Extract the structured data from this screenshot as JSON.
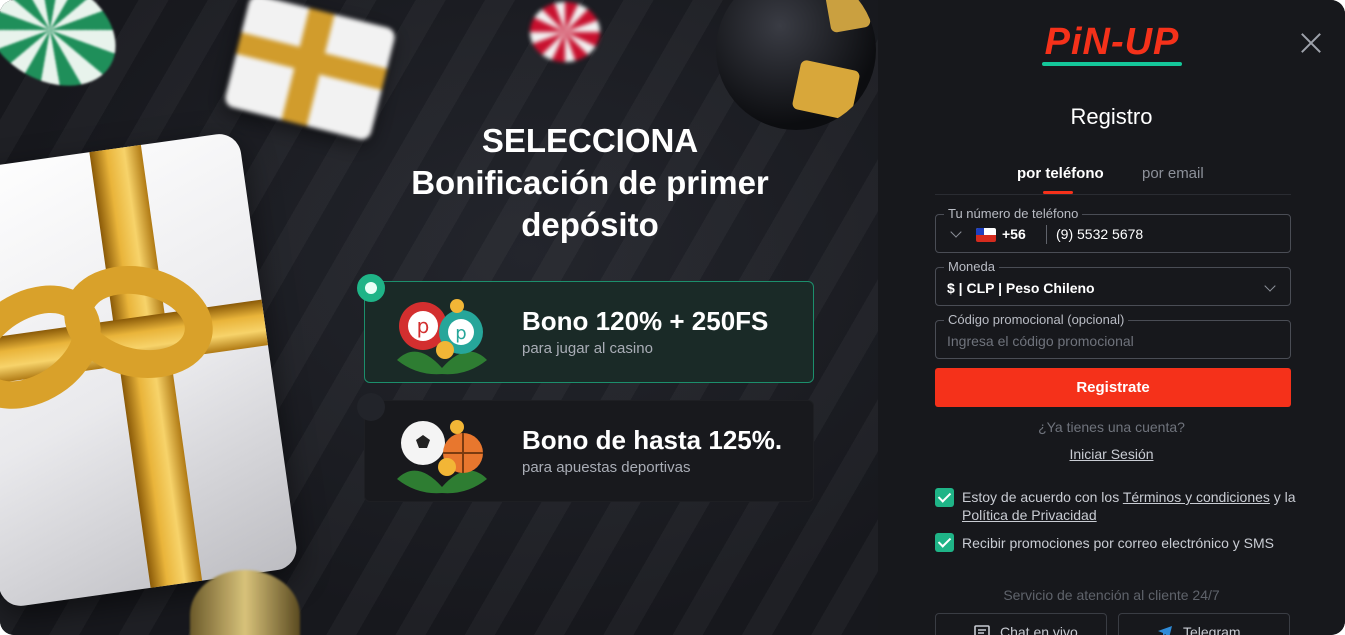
{
  "promo": {
    "headline_1": "SELECCIONA",
    "headline_2": "Bonificación de primer",
    "headline_3": "depósito",
    "bonuses": [
      {
        "title": "Bono 120% + 250FS",
        "subtitle": "para jugar al casino",
        "selected": true
      },
      {
        "title": "Bono de hasta 125%.",
        "subtitle": "para apuestas deportivas",
        "selected": false
      }
    ]
  },
  "panel": {
    "logo": "PiN-UP",
    "title": "Registro",
    "tabs": [
      {
        "label": "por teléfono",
        "active": true
      },
      {
        "label": "por email",
        "active": false
      }
    ],
    "phone": {
      "label": "Tu número de teléfono",
      "country_code": "+56",
      "value": "(9) 5532 5678"
    },
    "currency": {
      "label": "Moneda",
      "value": "$ | CLP | Peso Chileno"
    },
    "promo_code": {
      "label": "Código promocional (opcional)",
      "placeholder": "Ingresa el código promocional"
    },
    "register_button": "Registrate",
    "have_account": "¿Ya tienes una cuenta?",
    "login_link": "Iniciar Sesión",
    "terms": {
      "prefix": "Estoy de acuerdo con los ",
      "terms_link": "Términos y condiciones",
      "middle": " y la ",
      "privacy_link": "Política de Privacidad",
      "checked": true
    },
    "promos_consent": {
      "label": "Recibir promociones por correo electrónico y SMS",
      "checked": true
    },
    "support_text": "Servicio de atención al cliente 24/7",
    "chat_button": "Chat en vivo",
    "telegram_button": "Telegram"
  },
  "colors": {
    "accent_red": "#f5311a",
    "accent_green": "#1fb487",
    "panel_bg": "#17181c"
  },
  "icons": [
    "close-icon",
    "chevron-down-icon",
    "chile-flag-icon",
    "checkbox-checked-icon",
    "chat-icon",
    "telegram-icon"
  ]
}
